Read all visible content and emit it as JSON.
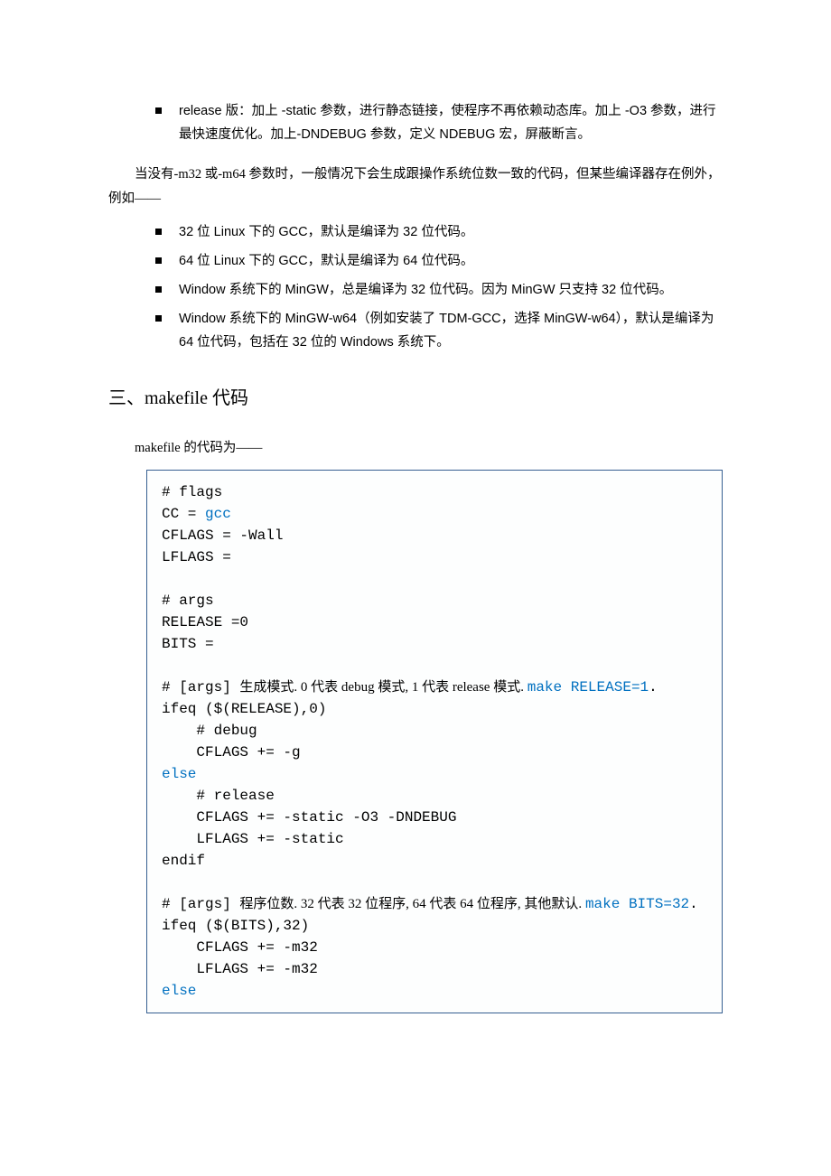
{
  "top_bullets": [
    "release 版：加上 -static 参数，进行静态链接，使程序不再依赖动态库。加上 -O3 参数，进行最快速度优化。加上-DNDEBUG 参数，定义 NDEBUG 宏，屏蔽断言。"
  ],
  "para_intro": "当没有-m32 或-m64 参数时，一般情况下会生成跟操作系统位数一致的代码，但某些编译器存在例外，例如——",
  "arch_bullets": [
    "32 位 Linux 下的 GCC，默认是编译为 32 位代码。",
    "64 位 Linux 下的 GCC，默认是编译为 64 位代码。",
    "Window 系统下的 MinGW，总是编译为 32 位代码。因为 MinGW 只支持 32 位代码。",
    "Window 系统下的 MinGW-w64（例如安装了 TDM-GCC，选择 MinGW-w64），默认是编译为 64 位代码，包括在 32 位的 Windows 系统下。"
  ],
  "section_title": "三、makefile 代码",
  "para_code_intro": "makefile 的代码为——",
  "code": {
    "l01": "# flags",
    "l02a": "CC = ",
    "l02b": "gcc",
    "l03": "CFLAGS = -Wall",
    "l04": "LFLAGS =",
    "l05": "",
    "l06": "# args",
    "l07": "RELEASE =0",
    "l08": "BITS =",
    "l09": "",
    "l10a": "# [args] ",
    "l10b": "生成模式. 0 代表 debug 模式, 1 代表 release 模式. ",
    "l10c": "make RELEASE=1",
    "l10d": ".",
    "l11": "ifeq ($(RELEASE),0)",
    "l12": "    # debug",
    "l13": "    CFLAGS += -g",
    "l14": "else",
    "l15": "    # release",
    "l16": "    CFLAGS += -static -O3 -DNDEBUG",
    "l17": "    LFLAGS += -static",
    "l18": "endif",
    "l19": "",
    "l20a": "# [args] ",
    "l20b": "程序位数. 32 代表 32 位程序, 64 代表 64 位程序, 其他默认. ",
    "l20c": "make BITS=32",
    "l20d": ".",
    "l21": "ifeq ($(BITS),32)",
    "l22": "    CFLAGS += -m32",
    "l23": "    LFLAGS += -m32",
    "l24": "else"
  }
}
